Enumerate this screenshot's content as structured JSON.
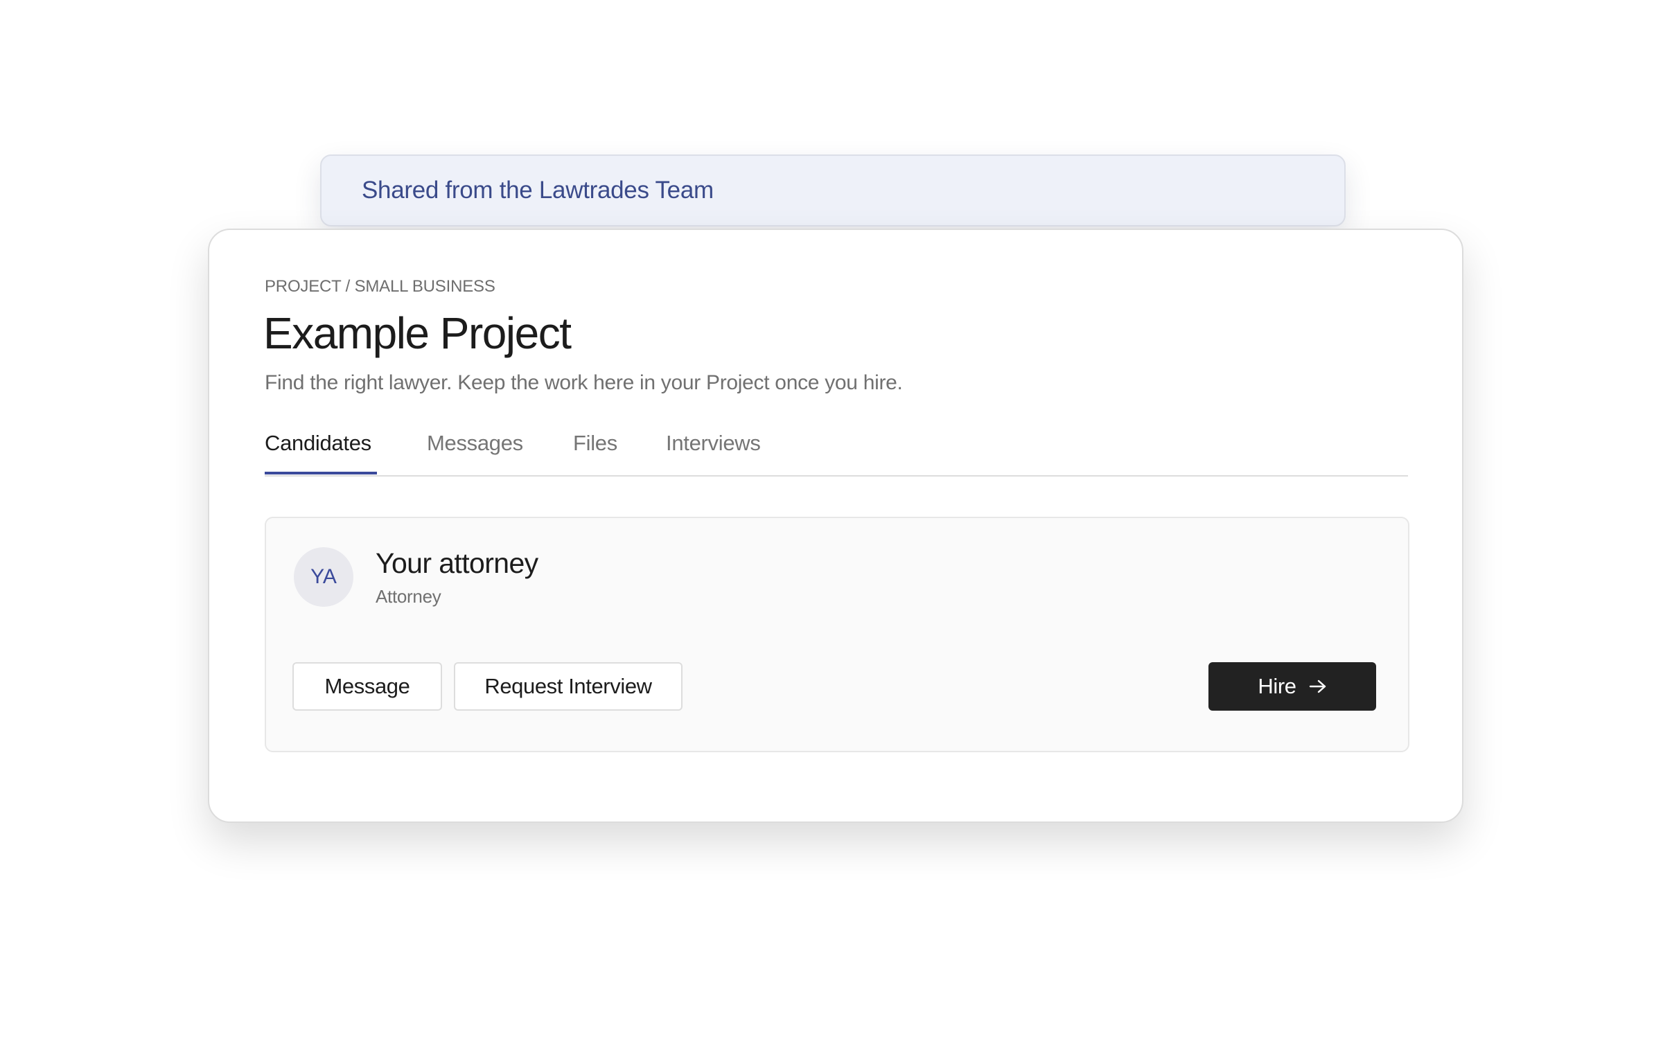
{
  "banner": {
    "text": "Shared from the Lawtrades Team"
  },
  "project": {
    "breadcrumb": "PROJECT / SMALL BUSINESS",
    "title": "Example Project",
    "subtitle": "Find the right lawyer. Keep the work here in your Project once you hire."
  },
  "tabs": [
    {
      "label": "Candidates",
      "active": true
    },
    {
      "label": "Messages",
      "active": false
    },
    {
      "label": "Files",
      "active": false
    },
    {
      "label": "Interviews",
      "active": false
    }
  ],
  "candidate": {
    "initials": "YA",
    "name": "Your attorney",
    "role": "Attorney",
    "actions": {
      "message_label": "Message",
      "interview_label": "Request Interview",
      "hire_label": "Hire",
      "hire_icon": "arrow-right-icon"
    }
  },
  "colors": {
    "accent": "#3b4a9b",
    "banner_bg": "#eef1f9",
    "hire_bg": "#222222"
  }
}
